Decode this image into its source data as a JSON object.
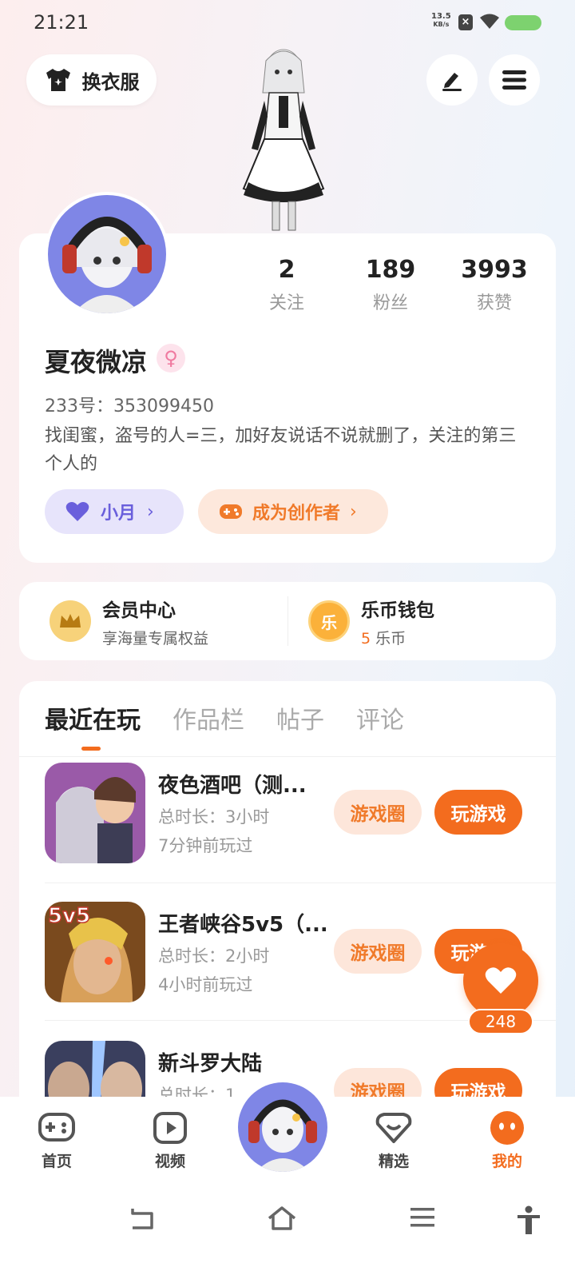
{
  "status_bar": {
    "time": "21:21",
    "net_speed": "13.5",
    "net_unit": "KB/s"
  },
  "top": {
    "outfit_label": "换衣服"
  },
  "profile": {
    "stats": [
      {
        "value": "2",
        "label": "关注"
      },
      {
        "value": "189",
        "label": "粉丝"
      },
      {
        "value": "3993",
        "label": "获赞"
      }
    ],
    "username": "夏夜微凉",
    "gender_symbol": "♀",
    "uid": "233号：353099450",
    "bio": "找闺蜜，盗号的人=三，加好友说话不说就删了，关注的第三个人的",
    "tag_moon": "小月",
    "tag_creator": "成为创作者"
  },
  "vip": {
    "member_title": "会员中心",
    "member_sub": "享海量专属权益",
    "wallet_title": "乐币钱包",
    "wallet_icon_text": "乐",
    "wallet_amount": "5",
    "wallet_unit": "乐币"
  },
  "tabs": [
    "最近在玩",
    "作品栏",
    "帖子",
    "评论"
  ],
  "games": [
    {
      "name": "夜色酒吧（测...",
      "duration": "总时长：3小时",
      "last": "7分钟前玩过",
      "circle": "游戏圈",
      "play": "玩游戏"
    },
    {
      "name": "王者峡谷5v5（...",
      "duration": "总时长：2小时",
      "last": "4小时前玩过",
      "circle": "游戏圈",
      "play": "玩游戏"
    },
    {
      "name": "新斗罗大陆",
      "duration": "总时长：1",
      "last": "",
      "circle": "游戏圈",
      "play": "玩游戏"
    }
  ],
  "game2_badge": "5v5",
  "like": {
    "count": "248"
  },
  "bottom_nav": {
    "home": "首页",
    "video": "视频",
    "featured": "精选",
    "mine": "我的"
  },
  "colors": {
    "accent": "#f36c1e",
    "purple": "#6a5fdc"
  }
}
